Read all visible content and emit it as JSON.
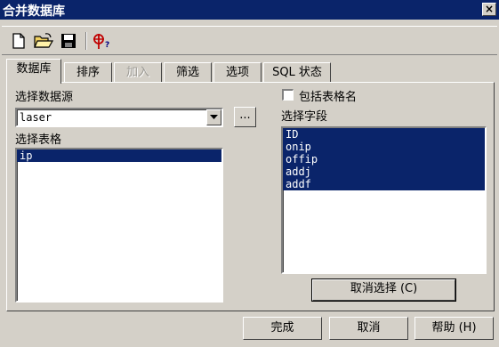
{
  "window": {
    "title": "合并数据库",
    "close_glyph": "×"
  },
  "toolbar": {
    "icons": [
      "new-file-icon",
      "open-folder-icon",
      "save-icon",
      "help-query-icon"
    ]
  },
  "tabs": [
    {
      "label": "数据库",
      "active": true,
      "enabled": true
    },
    {
      "label": "排序",
      "active": false,
      "enabled": true
    },
    {
      "label": "加入",
      "active": false,
      "enabled": false
    },
    {
      "label": "筛选",
      "active": false,
      "enabled": true
    },
    {
      "label": "选项",
      "active": false,
      "enabled": true
    },
    {
      "label": "SQL 状态",
      "active": false,
      "enabled": true
    }
  ],
  "datasource": {
    "label": "选择数据源",
    "value": "laser",
    "browse_label": "..."
  },
  "tables": {
    "label": "选择表格",
    "items": [
      {
        "text": "ip",
        "selected": true
      }
    ]
  },
  "include_table_name": {
    "label": "包括表格名",
    "checked": false
  },
  "fields": {
    "label": "选择字段",
    "items": [
      {
        "text": "ID",
        "selected": true
      },
      {
        "text": "onip",
        "selected": true
      },
      {
        "text": "offip",
        "selected": true
      },
      {
        "text": "addj",
        "selected": true
      },
      {
        "text": "addf",
        "selected": true
      }
    ]
  },
  "deselect_button": "取消选择 (C)",
  "footer": {
    "finish": "完成",
    "cancel": "取消",
    "help": "帮助 (H)"
  },
  "colors": {
    "face": "#d4d0c8",
    "titlebar": "#0a246a",
    "selection": "#0a246a"
  }
}
